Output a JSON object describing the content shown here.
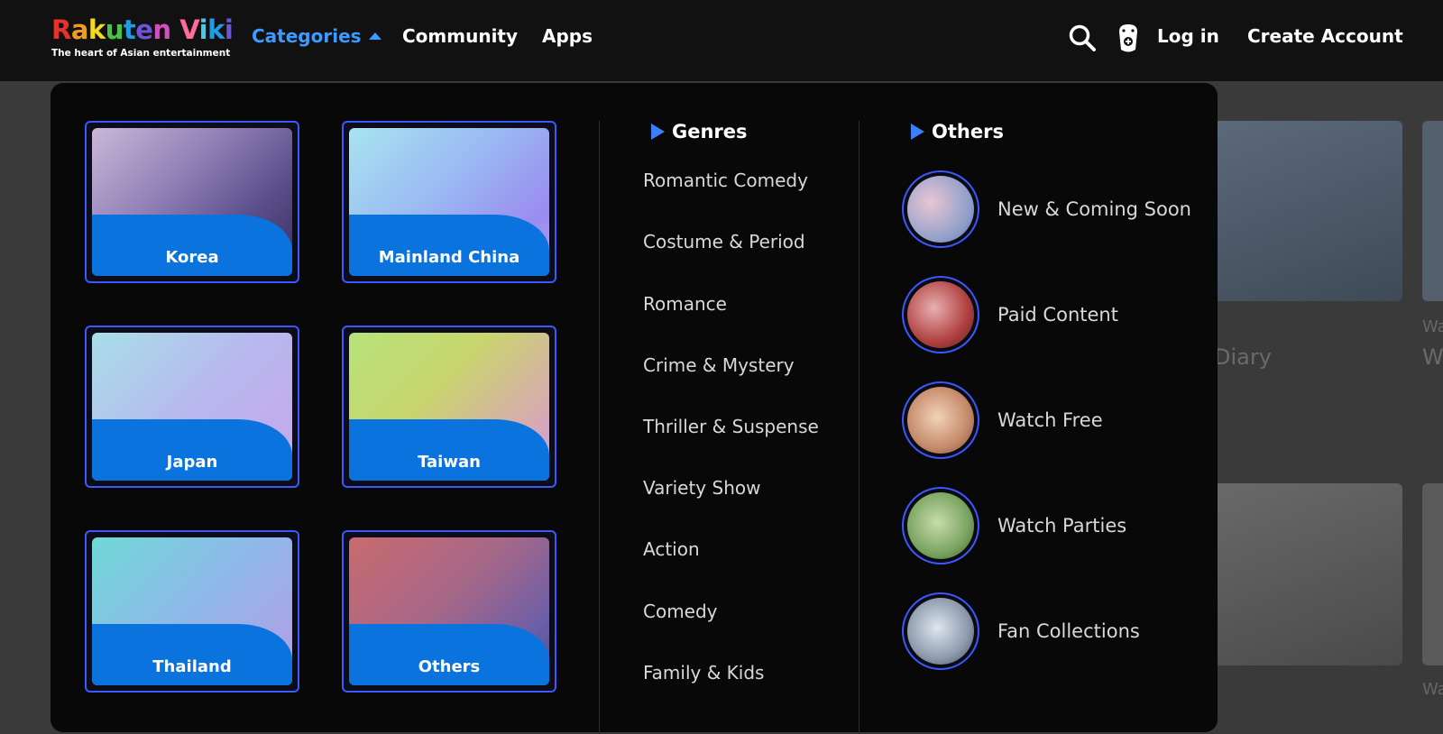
{
  "header": {
    "logo_word": "Rakuten Viki",
    "logo_tagline": "The heart of Asian entertainment",
    "nav": {
      "categories": "Categories",
      "community": "Community",
      "apps": "Apps"
    },
    "login": "Log in",
    "create_account": "Create Account"
  },
  "background": {
    "title_fragment_1": "Diary",
    "title_fragment_2": "W",
    "small_fragment_1": "Wa",
    "small_fragment_2": "Wa"
  },
  "dropdown": {
    "countries": [
      {
        "label": "Korea"
      },
      {
        "label": "Mainland China"
      },
      {
        "label": "Japan"
      },
      {
        "label": "Taiwan"
      },
      {
        "label": "Thailand"
      },
      {
        "label": "Others"
      }
    ],
    "genres_heading": "Genres",
    "genres": [
      "Romantic Comedy",
      "Costume & Period",
      "Romance",
      "Crime & Mystery",
      "Thriller & Suspense",
      "Variety Show",
      "Action",
      "Comedy",
      "Family & Kids"
    ],
    "others_heading": "Others",
    "others": [
      "New & Coming Soon",
      "Paid Content",
      "Watch Free",
      "Watch Parties",
      "Fan Collections"
    ]
  },
  "colors": {
    "accent_blue": "#3c9bff",
    "card_border": "#3b58ff",
    "label_bg": "#0b73de"
  }
}
